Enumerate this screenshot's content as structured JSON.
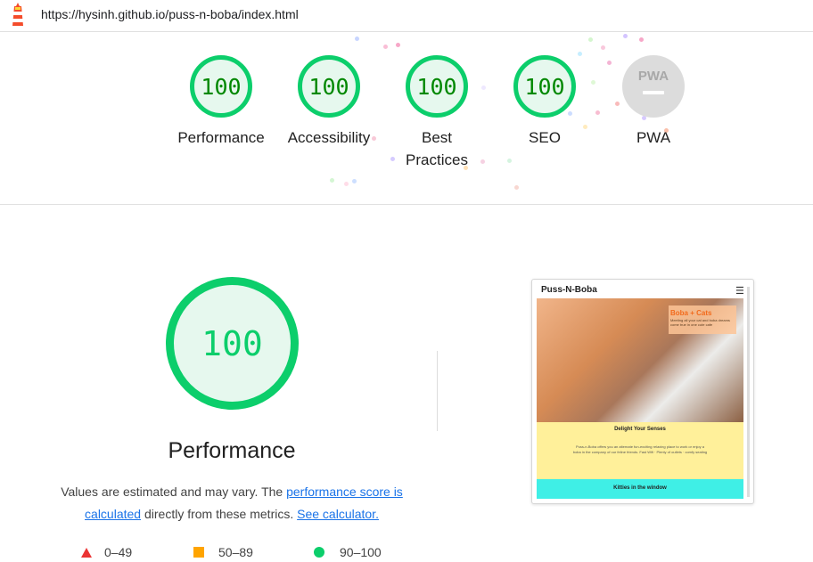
{
  "browser": {
    "url": "https://hysinh.github.io/puss-n-boba/index.html"
  },
  "categories": [
    {
      "label": "Performance",
      "score": "100"
    },
    {
      "label": "Accessibility",
      "score": "100"
    },
    {
      "label": "Best Practices",
      "score": "100"
    },
    {
      "label": "SEO",
      "score": "100"
    },
    {
      "label": "PWA",
      "score": ""
    }
  ],
  "performance": {
    "score": "100",
    "title": "Performance",
    "desc_prefix": "Values are estimated and may vary. The ",
    "link_score": "performance score is calculated",
    "desc_middle": " directly from these metrics. ",
    "link_calc": "See calculator."
  },
  "legend": [
    {
      "label": "0–49",
      "color": "#eb3434",
      "shape": "triangle"
    },
    {
      "label": "50–89",
      "color": "#ffa400",
      "shape": "square"
    },
    {
      "label": "90–100",
      "color": "#0cce6b",
      "shape": "circle"
    }
  ],
  "screenshot": {
    "site_title": "Puss-N-Boba",
    "hero_title": "Boba + Cats",
    "hero_text": "Meeting all your cat and boba dreams come true in one cute cafe",
    "section_title": "Delight Your Senses",
    "section_text": "Puss-n-Boba offers you an alternate fun-exciting relaxing place to work or enjoy a boba in the company of our feline friends. Fast Wifi · Plenty of outlets · comfy seating",
    "footer_title": "Kitties in the window"
  },
  "colors": {
    "pass": "#0cce6b",
    "pass_text": "#008800",
    "link": "#1a73e8"
  }
}
